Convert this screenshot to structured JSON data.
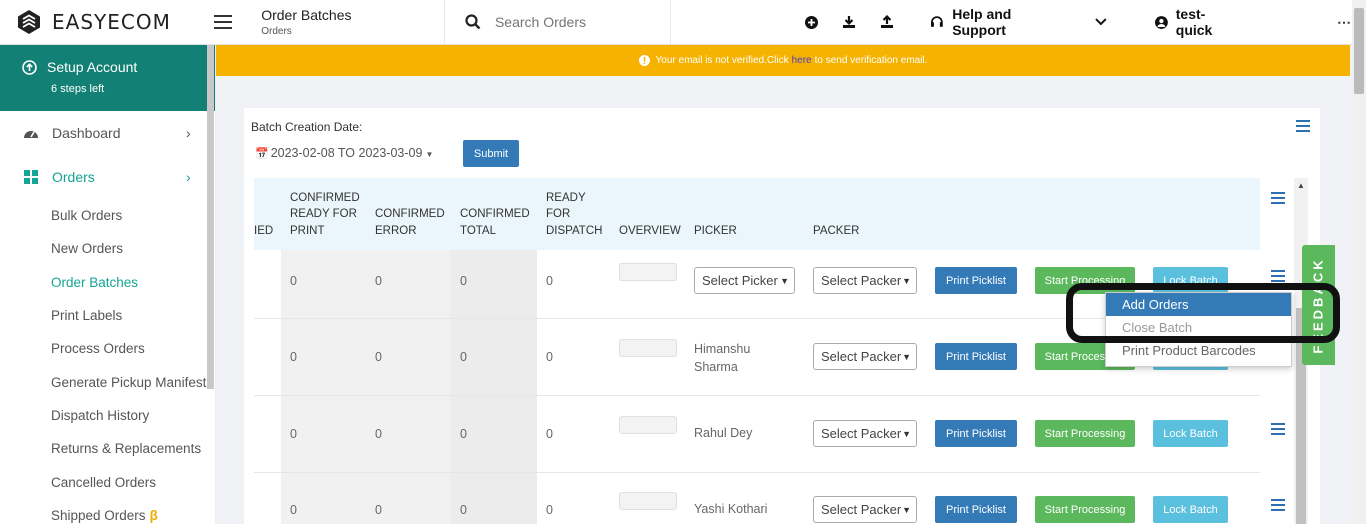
{
  "app": {
    "brand": "EASYECOM",
    "page_title": "Order Batches",
    "page_subtitle": "Orders",
    "search_placeholder": "Search Orders",
    "help_label": "Help and Support",
    "user_label": "test-quick",
    "more_label": "⋯"
  },
  "sidebar": {
    "setup_title": "Setup Account",
    "setup_sub": "6 steps left",
    "dashboard": "Dashboard",
    "orders": "Orders",
    "sub_items": [
      "Bulk Orders",
      "New Orders",
      "Order Batches",
      "Print Labels",
      "Process Orders",
      "Generate Pickup Manifest",
      "Dispatch History",
      "Returns & Replacements",
      "Cancelled Orders",
      "Shipped Orders"
    ],
    "beta_mark": "β"
  },
  "banner": {
    "before": "Your email is not verified.Click",
    "link": "here",
    "after": "to send verification email."
  },
  "filters": {
    "label": "Batch Creation Date:",
    "date_range": "2023-02-08 TO 2023-03-09",
    "submit": "Submit"
  },
  "table": {
    "headers": {
      "partial": "IED",
      "confirmed_ready_for_print": "CONFIRMED READY FOR PRINT",
      "confirmed_error": "CONFIRMED ERROR",
      "confirmed_total": "CONFIRMED TOTAL",
      "ready_for_dispatch": "READY FOR DISPATCH",
      "overview": "OVERVIEW",
      "picker": "PICKER",
      "packer": "PACKER"
    },
    "rows": [
      {
        "ready_print": "0",
        "error": "0",
        "total": "0",
        "dispatch": "0",
        "picker": "Select Picker",
        "packer": "Select Packer"
      },
      {
        "ready_print": "0",
        "error": "0",
        "total": "0",
        "dispatch": "0",
        "picker": "Himanshu Sharma",
        "packer": "Select Packer"
      },
      {
        "ready_print": "0",
        "error": "0",
        "total": "0",
        "dispatch": "0",
        "picker": "Rahul Dey",
        "packer": "Select Packer"
      },
      {
        "ready_print": "0",
        "error": "0",
        "total": "0",
        "dispatch": "0",
        "picker": "Yashi Kothari",
        "packer": "Select Packer"
      }
    ],
    "btn_print": "Print Picklist",
    "btn_start": "Start Processing",
    "btn_lock": "Lock Batch"
  },
  "dropdown": {
    "items": [
      "Add Orders",
      "Close Batch",
      "Print Product Barcodes"
    ]
  },
  "feedback_label": "FEEDBACK",
  "colors": {
    "teal": "#138075",
    "teal_active": "#15a595",
    "warning": "#f5b200",
    "primary": "#337ab7",
    "success": "#5cb85c",
    "info": "#5bc0de"
  }
}
